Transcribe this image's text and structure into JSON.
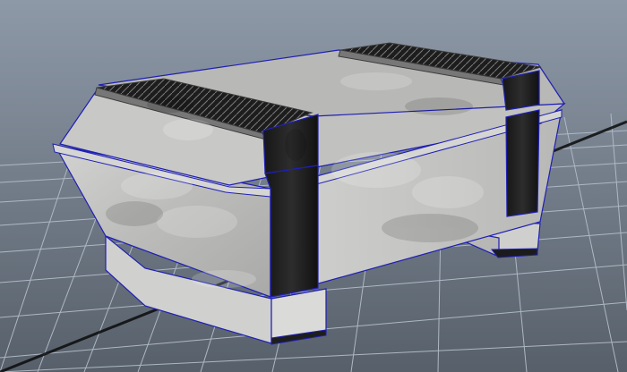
{
  "viewport": {
    "background_top": "#8e99a8",
    "background_bottom": "#57606a",
    "grid_color": "#aeb8c4",
    "grid_axis_color": "#0d0d0d"
  },
  "model": {
    "colors": {
      "light_panel": "#c9c9c8",
      "light_panel_dark": "#a8a8a6",
      "dark_strap": "#202020",
      "dark_strap_edge": "#4a4a4a",
      "wire_edge": "#1f1fb5"
    }
  }
}
